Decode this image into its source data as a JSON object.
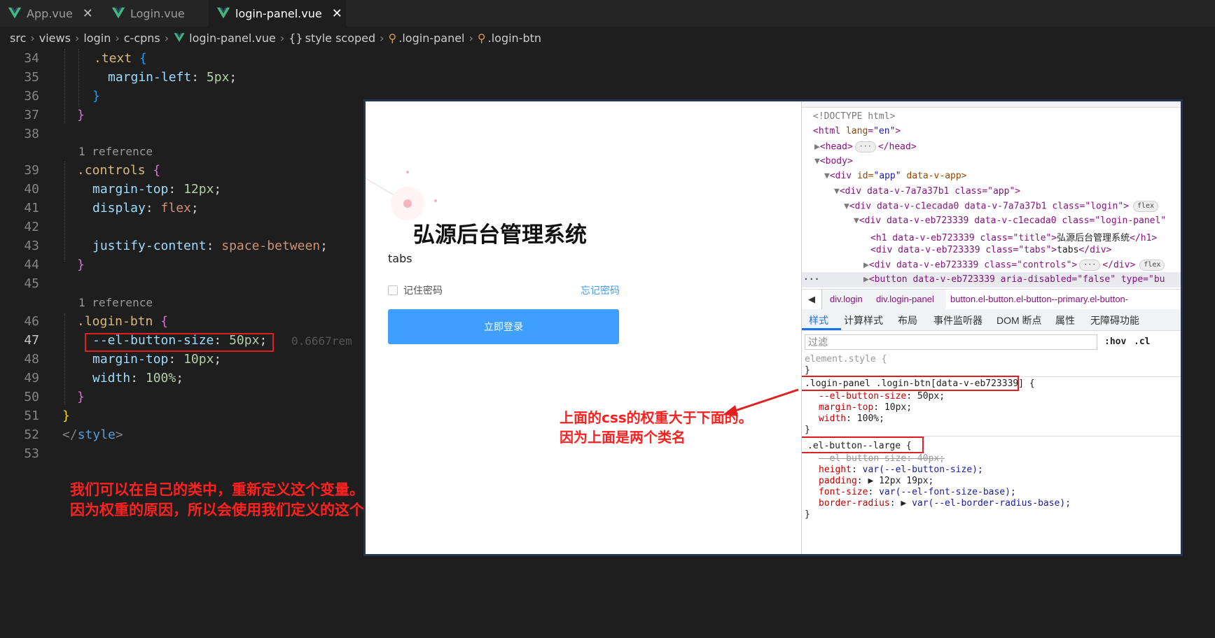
{
  "tabs": [
    {
      "label": "App.vue",
      "active": false
    },
    {
      "label": "Login.vue",
      "active": false
    },
    {
      "label": "login-panel.vue",
      "active": true
    }
  ],
  "breadcrumb": [
    "src",
    "views",
    "login",
    "c-cpns",
    "login-panel.vue",
    "style scoped",
    ".login-panel",
    ".login-btn"
  ],
  "editor": {
    "line_numbers": [
      "34",
      "35",
      "36",
      "37",
      "38",
      "39",
      "40",
      "41",
      "42",
      "43",
      "44",
      "45",
      "46",
      "47",
      "48",
      "49",
      "50",
      "51",
      "52",
      "53"
    ],
    "code": {
      "l34_sel": ".text",
      "l35_prop": "margin-left",
      "l35_val": "5px",
      "codelens_1": "1 reference",
      "l39_sel": ".controls",
      "l40_prop": "margin-top",
      "l40_val": "12px",
      "l41_prop": "display",
      "l41_val": "flex",
      "l43_prop": "justify-content",
      "l43_val": "space-between",
      "codelens_2": "1 reference",
      "l46_sel": ".login-btn",
      "l47_prop": "--el-button-size",
      "l47_val": "50px",
      "l47_hint": "0.6667rem",
      "l48_prop": "margin-top",
      "l48_val": "10px",
      "l49_prop": "width",
      "l49_val": "100%",
      "l52_tag": "style"
    },
    "note": {
      "line1": "我们可以在自己的类中，重新定义这个变量。",
      "line2": "因为权重的原因，所以会使用我们定义的这个CSS变量"
    }
  },
  "login_panel": {
    "title": "弘源后台管理系统",
    "tabs_text": "tabs",
    "remember_label": "记住密码",
    "forgot_link": "忘记密码",
    "login_button": "立即登录",
    "primary_color": "#409eff"
  },
  "devtools": {
    "dom": {
      "doctype": "<!DOCTYPE html>",
      "html_open": "<html ",
      "lang_attr": "lang",
      "lang_val": "\"en\"",
      "head_open": "<head>",
      "head_close": "</head>",
      "body_open": "<body>",
      "app_tag": "<div ",
      "app_attrs": "id=",
      "app_id": "\"app\"",
      "app_rest": " data-v-app>",
      "div_app": "<div data-v-7a7a37b1 class=\"app\">",
      "div_login": "<div data-v-c1ecada0 data-v-7a7a37b1 class=\"login\">",
      "div_login_panel": "<div data-v-eb723339 data-v-c1ecada0 class=\"login-panel\"",
      "h1_open": "<h1 data-v-eb723339 class=\"title\">",
      "h1_text": "弘源后台管理系统",
      "h1_close": "</h1>",
      "tabs_div": "<div data-v-eb723339 class=\"tabs\">",
      "tabs_text": "tabs",
      "tabs_close": "</div>",
      "controls_div": "<div data-v-eb723339 class=\"controls\">",
      "controls_close": "</div>",
      "button_line": "<button data-v-eb723339 aria-disabled=\"false\" type=\"bu",
      "flex_badge": "flex",
      "ellipsis": "..."
    },
    "element_breadcrumb": [
      "div.login",
      "div.login-panel",
      "button.el-button.el-button--primary.el-button-"
    ],
    "panel_tabs": [
      "样式",
      "计算样式",
      "布局",
      "事件监听器",
      "DOM 断点",
      "属性",
      "无障碍功能"
    ],
    "filter_placeholder": "过滤",
    "hov_label": ":hov",
    "cls_label": ".cl",
    "element_style": "element.style {",
    "rule1": {
      "selector": ".login-panel .login-btn[data-v-eb723339]",
      "decls": [
        {
          "prop": "--el-button-size",
          "val": "50px"
        },
        {
          "prop": "margin-top",
          "val": "10px"
        },
        {
          "prop": "width",
          "val": "100%"
        }
      ]
    },
    "rule2": {
      "selector": ".el-button--large {",
      "struck": "--el-button-size: 40px;",
      "decls": [
        {
          "prop": "height",
          "val": "var(--el-button-size);"
        },
        {
          "prop": "padding",
          "val": "12px 19px;"
        },
        {
          "prop": "font-size",
          "val": "var(--el-font-size-base);"
        },
        {
          "prop": "border-radius",
          "val": "var(--el-border-radius-base);"
        }
      ]
    },
    "annotation": {
      "line1": "上面的css的权重大于下面的。",
      "line2": "因为上面是两个类名"
    }
  }
}
